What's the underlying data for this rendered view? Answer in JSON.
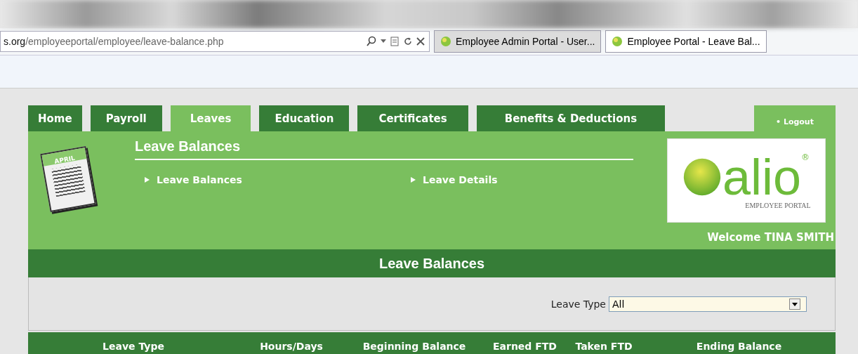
{
  "browser": {
    "address": {
      "host": "s.org",
      "path": "/employeeportal/employee/leave-balance.php"
    },
    "tabs": [
      {
        "label": "Employee Admin Portal - User...",
        "selected": false
      },
      {
        "label": "Employee Portal - Leave Bal...",
        "selected": true
      }
    ]
  },
  "nav": {
    "tabs": [
      {
        "label": "Home",
        "selected": false
      },
      {
        "label": "Payroll",
        "selected": false
      },
      {
        "label": "Leaves",
        "selected": true
      },
      {
        "label": "Education",
        "selected": false
      },
      {
        "label": "Certificates",
        "selected": false
      },
      {
        "label": "Benefits & Deductions",
        "selected": false
      }
    ],
    "logout": "• Logout"
  },
  "banner": {
    "calendar_month": "APRIL",
    "title": "Leave Balances",
    "links": [
      "Leave Balances",
      "Leave Details"
    ],
    "logo": {
      "wordmark": "alio",
      "registered": "®",
      "tagline": "EMPLOYEE PORTAL"
    },
    "welcome": "Welcome TINA SMITH"
  },
  "section": {
    "title": "Leave Balances",
    "filter": {
      "label": "Leave Type",
      "value": "All"
    },
    "columns": [
      "Leave Type",
      "Hours/Days",
      "Beginning Balance",
      "Earned FTD",
      "Taken FTD",
      "Ending Balance"
    ]
  }
}
